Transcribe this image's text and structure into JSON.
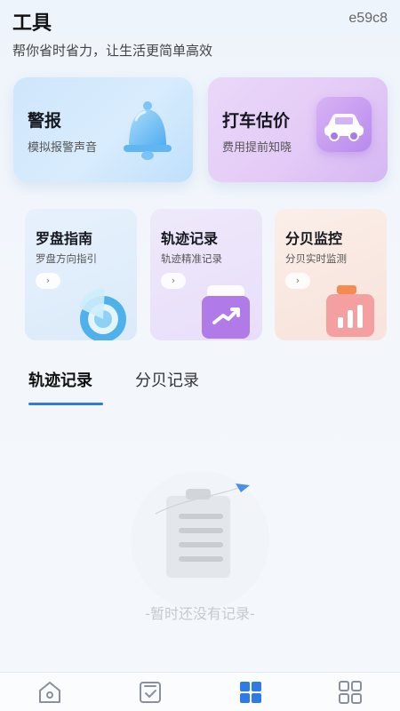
{
  "header": {
    "title": "工具",
    "subtitle": "帮你省时省力，让生活更简单高效",
    "code": "e59c8"
  },
  "big_cards": [
    {
      "title": "警报",
      "subtitle": "模拟报警声音",
      "icon": "bell-icon"
    },
    {
      "title": "打车估价",
      "subtitle": "费用提前知晓",
      "icon": "car-icon"
    }
  ],
  "small_cards": [
    {
      "title": "罗盘指南",
      "subtitle": "罗盘方向指引",
      "arrow": "›",
      "icon": "compass-icon"
    },
    {
      "title": "轨迹记录",
      "subtitle": "轨迹精准记录",
      "arrow": "›",
      "icon": "trend-clipboard-icon"
    },
    {
      "title": "分贝监控",
      "subtitle": "分贝实时监测",
      "arrow": "›",
      "icon": "bar-chart-icon"
    }
  ],
  "tabs": [
    {
      "label": "轨迹记录",
      "active": true
    },
    {
      "label": "分贝记录",
      "active": false
    }
  ],
  "empty": {
    "text": "-暂时还没有记录-",
    "icon": "empty-clipboard-icon"
  },
  "nav": [
    {
      "icon": "home-icon",
      "active": false
    },
    {
      "icon": "checklist-icon",
      "active": false
    },
    {
      "icon": "tools-grid-icon",
      "active": true
    },
    {
      "icon": "apps-icon",
      "active": false
    }
  ],
  "colors": {
    "accent": "#2f7be6",
    "inactive_icon": "#8a9099",
    "empty_text": "#c5cad2"
  }
}
